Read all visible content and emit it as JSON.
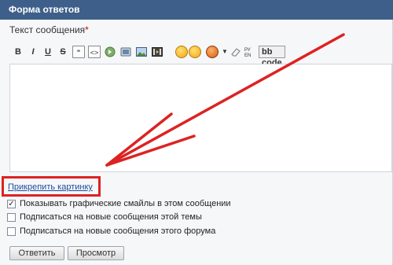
{
  "header": {
    "title": "Форма ответов"
  },
  "field": {
    "label": "Текст сообщения",
    "required_mark": "*",
    "value": ""
  },
  "toolbar": {
    "bold": "B",
    "italic": "I",
    "underline": "U",
    "strike": "S",
    "quote": "\"",
    "code": "<>",
    "bbcode_label": "bb code"
  },
  "attach": {
    "label": "Прикрепить картинку"
  },
  "options": [
    {
      "label": "Показывать графические смайлы в этом сообщении",
      "checked": true
    },
    {
      "label": "Подписаться на новые сообщения этой темы",
      "checked": false
    },
    {
      "label": "Подписаться на новые сообщения этого форума",
      "checked": false
    }
  ],
  "buttons": {
    "submit": "Ответить",
    "preview": "Просмотр"
  },
  "colors": {
    "header_bg": "#3e5f8a",
    "arrow": "#dd2222",
    "link": "#1f4b9a"
  },
  "icons": [
    "bold-icon",
    "italic-icon",
    "underline-icon",
    "strike-icon",
    "quote-icon",
    "code-icon",
    "audio-icon",
    "video-icon",
    "image-icon",
    "media-icon",
    "smile-icon",
    "sad-smile-icon",
    "devil-smile-icon",
    "eraser-icon",
    "translit-icon"
  ]
}
